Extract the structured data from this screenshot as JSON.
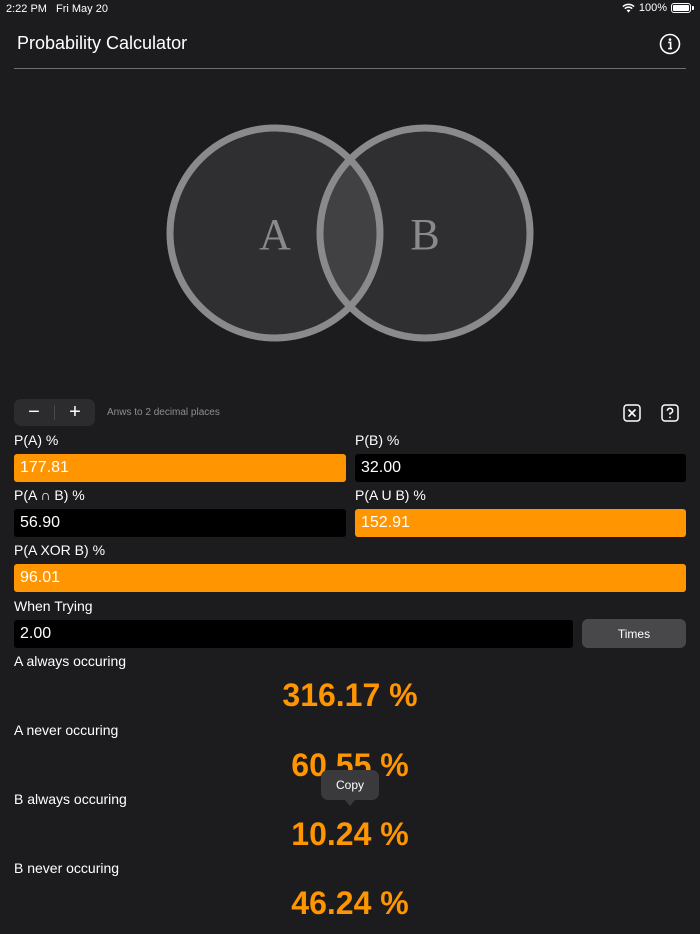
{
  "status_bar": {
    "time": "2:22 PM",
    "date": "Fri May 20",
    "battery": "100%"
  },
  "header": {
    "title": "Probability Calculator",
    "info_icon": "info-circle-icon"
  },
  "venn": {
    "label_a": "A",
    "label_b": "B"
  },
  "controls": {
    "minus": "−",
    "plus": "+",
    "hint": "Anws to 2 decimal places",
    "clear_icon": "x-square-icon",
    "help_icon": "question-square-icon"
  },
  "fields": {
    "pa": {
      "label": "P(A) %",
      "value": "177.81",
      "highlight": true
    },
    "pb": {
      "label": "P(B) %",
      "value": "32.00",
      "highlight": false
    },
    "pab": {
      "label": "P(A ∩ B) %",
      "value": "56.90",
      "highlight": false
    },
    "paub": {
      "label": "P(A U B) %",
      "value": "152.91",
      "highlight": true
    },
    "pxor": {
      "label": "P(A XOR B) %",
      "value": "96.01",
      "highlight": true
    },
    "trying": {
      "label": "When Trying",
      "value": "2.00"
    }
  },
  "times_button": "Times",
  "results": [
    {
      "label": "A always occuring",
      "value": "316.17 %"
    },
    {
      "label": "A never occuring",
      "value": "60.55 %"
    },
    {
      "label": "B always occuring",
      "value": "10.24 %"
    },
    {
      "label": "B never occuring",
      "value": "46.24 %"
    }
  ],
  "tooltip": "Copy",
  "colors": {
    "background": "#1c1c1e",
    "accent": "#ff9500",
    "field": "#000000"
  }
}
